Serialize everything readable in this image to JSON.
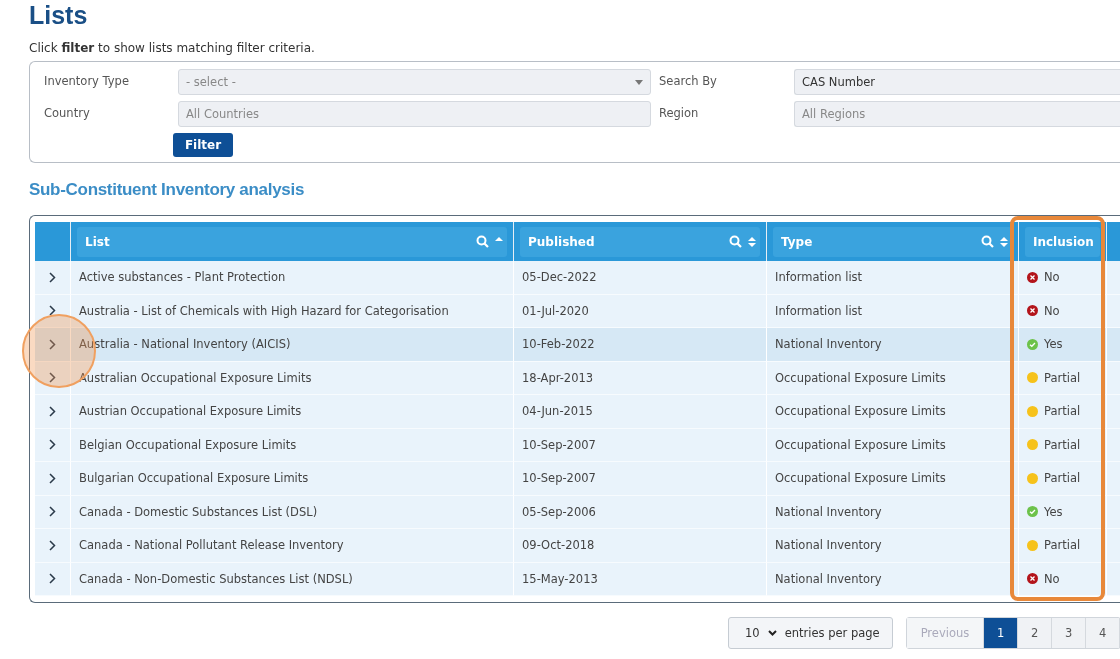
{
  "title": "Lists",
  "hint": "Click **filter** to show lists matching filter criteria.",
  "filters": [
    {
      "label": "Inventory Type",
      "kind": "select",
      "placeholder": "- select -"
    },
    {
      "label": "Search By",
      "kind": "input",
      "value": "CAS Number"
    },
    {
      "label": "Country",
      "kind": "input",
      "placeholder": "All Countries"
    },
    {
      "label": "Region",
      "kind": "input",
      "placeholder": "All Regions"
    }
  ],
  "filter_button": "Filter",
  "section_title": "Sub-Constituent Inventory analysis",
  "table": {
    "columns": [
      {
        "label": "List",
        "searchable": true,
        "sortable": true,
        "sorted": true
      },
      {
        "label": "Published",
        "searchable": true,
        "sortable": true,
        "sorted": false
      },
      {
        "label": "Type",
        "searchable": true,
        "sortable": true,
        "sorted": false
      },
      {
        "label": "Inclusion",
        "searchable": false,
        "sortable": false
      }
    ],
    "rows": [
      {
        "list": "Active substances - Plant Protection",
        "published": "05-Dec-2022",
        "type": "Information list",
        "inclusion": "No",
        "kind": "no",
        "highlighted": false
      },
      {
        "list": "Australia - List of Chemicals with High Hazard for Categorisation",
        "published": "01-Jul-2020",
        "type": "Information list",
        "inclusion": "No",
        "kind": "no",
        "highlighted": false
      },
      {
        "list": "Australia - National Inventory (AICIS)",
        "published": "10-Feb-2022",
        "type": "National Inventory",
        "inclusion": "Yes",
        "kind": "yes",
        "highlighted": true
      },
      {
        "list": "Australian Occupational Exposure Limits",
        "published": "18-Apr-2013",
        "type": "Occupational Exposure Limits",
        "inclusion": "Partial",
        "kind": "partial",
        "highlighted": false
      },
      {
        "list": "Austrian Occupational Exposure Limits",
        "published": "04-Jun-2015",
        "type": "Occupational Exposure Limits",
        "inclusion": "Partial",
        "kind": "partial",
        "highlighted": false
      },
      {
        "list": "Belgian Occupational Exposure Limits",
        "published": "10-Sep-2007",
        "type": "Occupational Exposure Limits",
        "inclusion": "Partial",
        "kind": "partial",
        "highlighted": false
      },
      {
        "list": "Bulgarian Occupational Exposure Limits",
        "published": "10-Sep-2007",
        "type": "Occupational Exposure Limits",
        "inclusion": "Partial",
        "kind": "partial",
        "highlighted": false
      },
      {
        "list": "Canada - Domestic Substances List (DSL)",
        "published": "05-Sep-2006",
        "type": "National Inventory",
        "inclusion": "Yes",
        "kind": "yes",
        "highlighted": false
      },
      {
        "list": "Canada - National Pollutant Release Inventory",
        "published": "09-Oct-2018",
        "type": "National Inventory",
        "inclusion": "Partial",
        "kind": "partial",
        "highlighted": false
      },
      {
        "list": "Canada - Non-Domestic Substances List (NDSL)",
        "published": "15-May-2013",
        "type": "National Inventory",
        "inclusion": "No",
        "kind": "no",
        "highlighted": false
      }
    ]
  },
  "page_size": {
    "value": "10",
    "label": "entries per page"
  },
  "pagination": {
    "previous": {
      "label": "Previous",
      "disabled": true
    },
    "pages": [
      {
        "label": "1",
        "selected": true
      },
      {
        "label": "2",
        "selected": false
      },
      {
        "label": "3",
        "selected": false
      },
      {
        "label": "4",
        "selected": false
      }
    ]
  }
}
